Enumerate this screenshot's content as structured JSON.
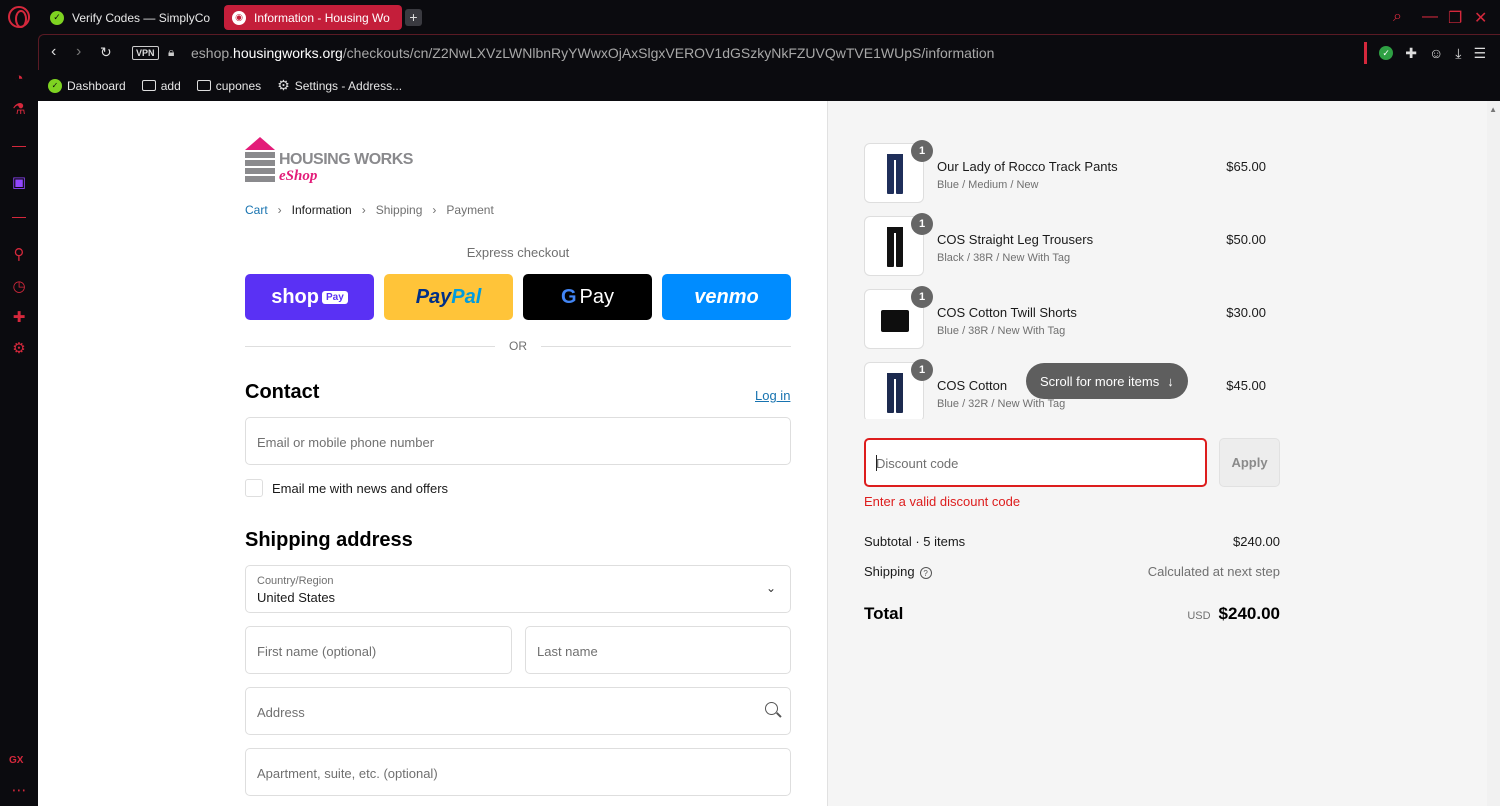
{
  "browser": {
    "tabs": [
      {
        "label": "Verify Codes — SimplyCo",
        "icon": "simplycodes-icon"
      },
      {
        "label": "Information - Housing Wo",
        "icon": "globe-icon"
      }
    ],
    "new_tab": "+",
    "url_host": "eshop.",
    "url_domain": "housingworks.org",
    "url_path": "/checkouts/cn/Z2NwLXVzLWNlbnRyYWwxOjAxSlgxVEROV1dGSzkyNkFZUVQwTVE1WUpS/information",
    "vpn_label": "VPN",
    "bookmarks": [
      "Dashboard",
      "add",
      "cupones",
      "Settings - Address..."
    ],
    "sidebar_badge": "GX",
    "accent_color": "#d5283c"
  },
  "shop": {
    "logo_text": "HOUSING WORKS",
    "logo_shop": "eShop",
    "breadcrumbs": [
      "Cart",
      "Information",
      "Shipping",
      "Payment"
    ],
    "express_checkout": "Express checkout",
    "pay_buttons": {
      "shoppay": "shop",
      "shoppay_pill": "Pay",
      "paypal_a": "Pay",
      "paypal_b": "Pal",
      "gpay_g": "G",
      "gpay": "Pay",
      "venmo": "venmo"
    },
    "or": "OR",
    "contact_heading": "Contact",
    "login_link": "Log in",
    "email_placeholder": "Email or mobile phone number",
    "news_checkbox": "Email me with news and offers",
    "shipping_heading": "Shipping address",
    "country_label": "Country/Region",
    "country_value": "United States",
    "first_name_placeholder": "First name (optional)",
    "last_name_placeholder": "Last name",
    "address_placeholder": "Address",
    "apt_placeholder": "Apartment, suite, etc. (optional)"
  },
  "summary": {
    "items": [
      {
        "qty": "1",
        "name": "Our Lady of Rocco Track Pants",
        "variant": "Blue / Medium / New",
        "price": "$65.00",
        "color": "#1f2f5a"
      },
      {
        "qty": "1",
        "name": "COS Straight Leg Trousers",
        "variant": "Black / 38R / New With Tag",
        "price": "$50.00",
        "color": "#111111"
      },
      {
        "qty": "1",
        "name": "COS Cotton Twill Shorts",
        "variant": "Blue / 38R / New With Tag",
        "price": "$30.00",
        "color": "#0e0e0e"
      },
      {
        "qty": "1",
        "name": "COS Cotton",
        "variant": "Blue / 32R / New With Tag",
        "price": "$45.00",
        "color": "#1c2a4f"
      }
    ],
    "scroll_hint": "Scroll for more items",
    "discount_placeholder": "Discount code",
    "apply_label": "Apply",
    "discount_error": "Enter a valid discount code",
    "subtotal_label": "Subtotal · 5 items",
    "subtotal_value": "$240.00",
    "shipping_label": "Shipping",
    "shipping_value": "Calculated at next step",
    "total_label": "Total",
    "total_currency": "USD",
    "total_value": "$240.00",
    "error_color": "#dd1d1d"
  }
}
